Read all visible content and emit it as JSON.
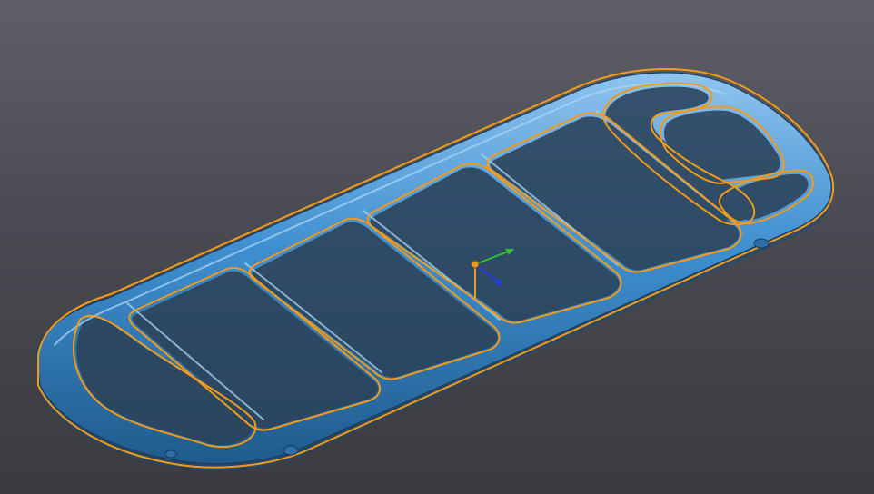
{
  "viewport": {
    "background_top": "#5e5f67",
    "background_bottom": "#3a3b40",
    "model_fill": "#3f8fd0",
    "model_shadow": "#1f5b8c",
    "model_highlight": "#8fc4ee",
    "outline_color": "#f29a1a",
    "axis_x_color": "#2fc22f",
    "axis_y_color": "#2040e0",
    "axis_z_color": "#e89a2a",
    "pivot_color": "#e89a2a"
  },
  "scene_objects": {
    "model": "ladder-frame-mesh",
    "gizmo": "transform-axes-gizmo"
  }
}
